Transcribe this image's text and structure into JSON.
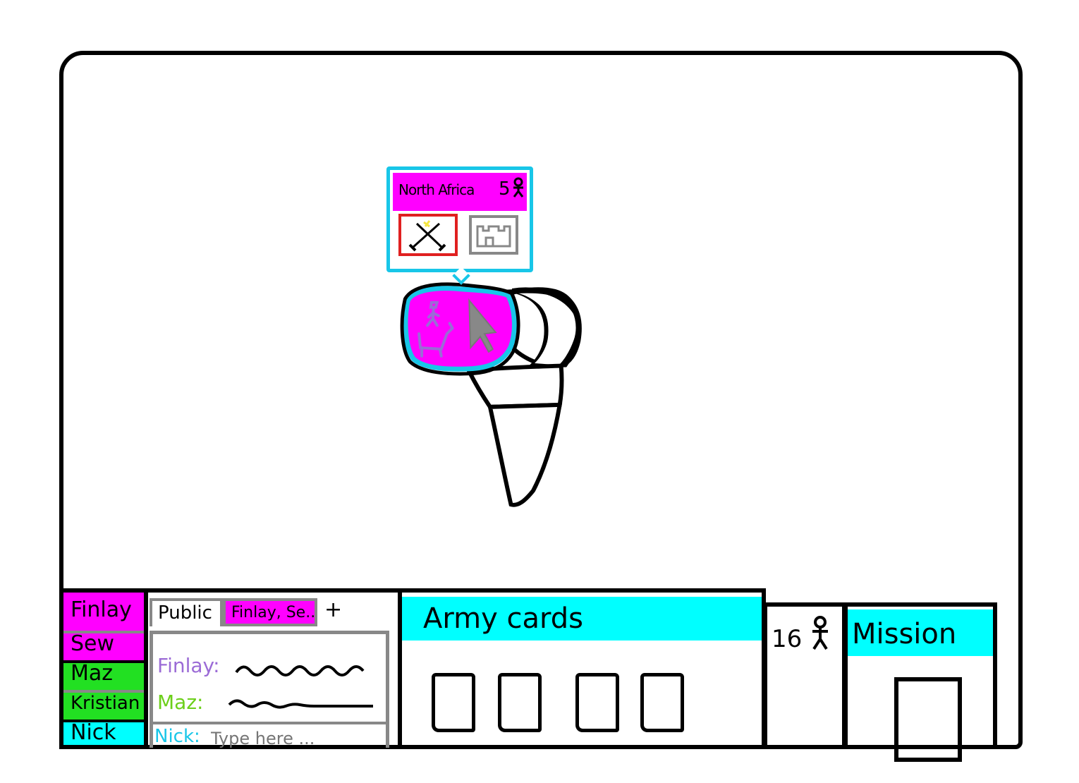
{
  "colors": {
    "player_magenta": "#ff00ff",
    "player_green": "#22e022",
    "player_cyan": "#00ffff",
    "finlay_name": "#9b6bd6",
    "maz_name": "#6ccf1a",
    "nick_name": "#18c6e8",
    "neutral_gray": "#888888",
    "attack_red": "#e02020"
  },
  "territory_popup": {
    "name": "North Africa",
    "troop_count": "5",
    "troop_icon": "person-icon",
    "actions": [
      {
        "icon": "crossed-swords-icon",
        "highlight": "attack_red"
      },
      {
        "icon": "fortress-icon",
        "highlight": "neutral_gray"
      }
    ]
  },
  "players": [
    {
      "name": "Finlay",
      "color": "player_magenta"
    },
    {
      "name": "Sew",
      "color": "player_magenta"
    },
    {
      "name": "Maz",
      "color": "player_green"
    },
    {
      "name": "Kristian",
      "color": "player_green"
    },
    {
      "name": "Nick",
      "color": "player_cyan"
    }
  ],
  "chat": {
    "tabs": [
      {
        "label": "Public"
      },
      {
        "label": "Finlay, Se..."
      },
      {
        "label": "+"
      }
    ],
    "messages": [
      {
        "sender": "Finlay:"
      },
      {
        "sender": "Maz:"
      }
    ],
    "input_sender": "Nick:",
    "input_placeholder": "Type here ..."
  },
  "army_cards": {
    "title": "Army cards",
    "card_count": 4
  },
  "troops": {
    "count": "16",
    "icon": "person-icon"
  },
  "mission": {
    "title": "Mission"
  }
}
